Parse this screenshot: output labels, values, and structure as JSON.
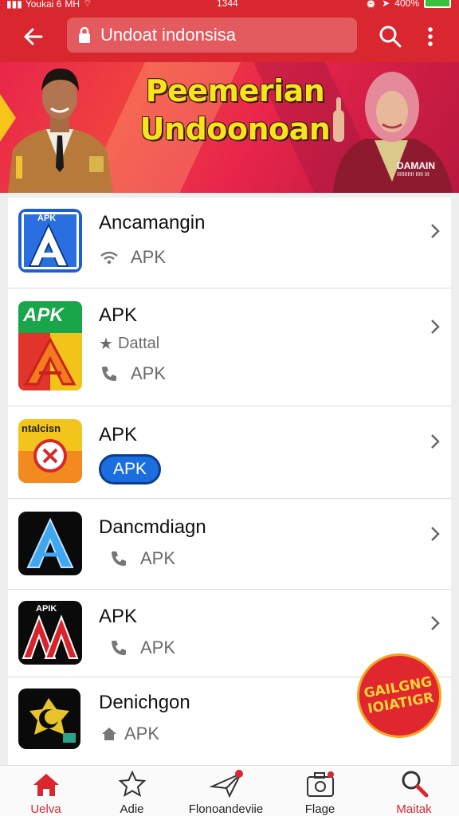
{
  "status_bar": {
    "carrier": "Youkai 6",
    "network": "MH",
    "time": "1344",
    "battery": "400%"
  },
  "app_bar": {
    "search_value": "Undoat indonsisa"
  },
  "banner": {
    "headline_line1": "Peemerian",
    "headline_line2": "Undoonoan",
    "badge": "DAMAIN",
    "badge_sub": "IIIIIIIIIII IIIII III"
  },
  "apps": [
    {
      "name": "Ancamangin",
      "icon_label": "APK",
      "meta1_icon": "wifi-icon",
      "meta1": "APK"
    },
    {
      "name": "APK",
      "icon_label": "APK",
      "meta1_icon": "star-icon",
      "meta1": "Dattal",
      "meta2_icon": "phone-icon",
      "meta2": "APK"
    },
    {
      "name": "APK",
      "icon_label": "ntalcisn",
      "pill": "APK"
    },
    {
      "name": "Dancmdiagn",
      "meta1_icon": "phone-icon",
      "meta1": "APK"
    },
    {
      "name": "APK",
      "icon_label": "APIK",
      "meta1_icon": "phone-icon",
      "meta1": "APK"
    },
    {
      "name": "Denichgon",
      "meta1_icon": "house-icon",
      "meta1": "APK"
    }
  ],
  "fab": {
    "line1": "GAILGNG",
    "line2": "IOIATIGR"
  },
  "bottom_nav": [
    {
      "label": "Uelva",
      "icon": "home-icon",
      "active": true
    },
    {
      "label": "Adie",
      "icon": "star-icon"
    },
    {
      "label": "Flonoandeviie",
      "icon": "send-icon"
    },
    {
      "label": "Flage",
      "icon": "camera-icon"
    },
    {
      "label": "Maitak",
      "icon": "search-icon",
      "active": true
    }
  ],
  "colors": {
    "primary": "#d8272f",
    "banner_text": "#f8e41a",
    "active_nav": "#d8272f"
  }
}
